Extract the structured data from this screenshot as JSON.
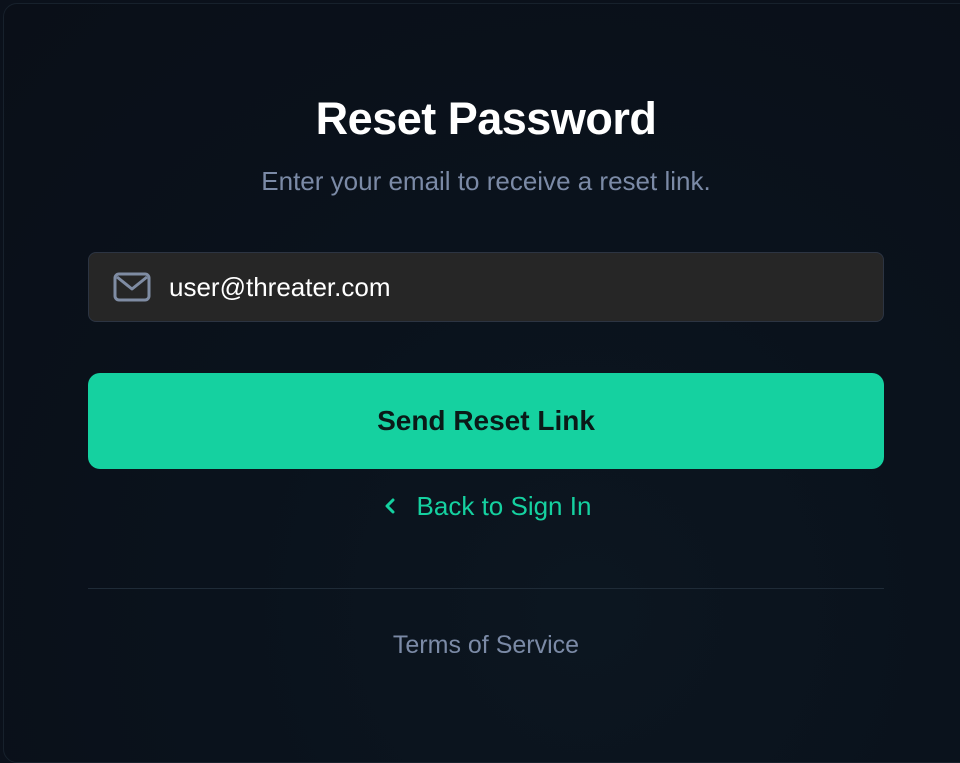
{
  "page": {
    "title": "Reset Password",
    "subtitle": "Enter your email to receive a reset link."
  },
  "form": {
    "email_icon": "mail-icon",
    "email_value": "user@threater.com",
    "submit_label": "Send Reset Link",
    "back_icon": "chevron-left-icon",
    "back_label": "Back to Sign In"
  },
  "footer": {
    "terms_label": "Terms of Service"
  },
  "colors": {
    "accent": "#15d1a0",
    "background": "#0b111b",
    "input_background": "#262626",
    "muted_text": "#7b8aa6"
  }
}
